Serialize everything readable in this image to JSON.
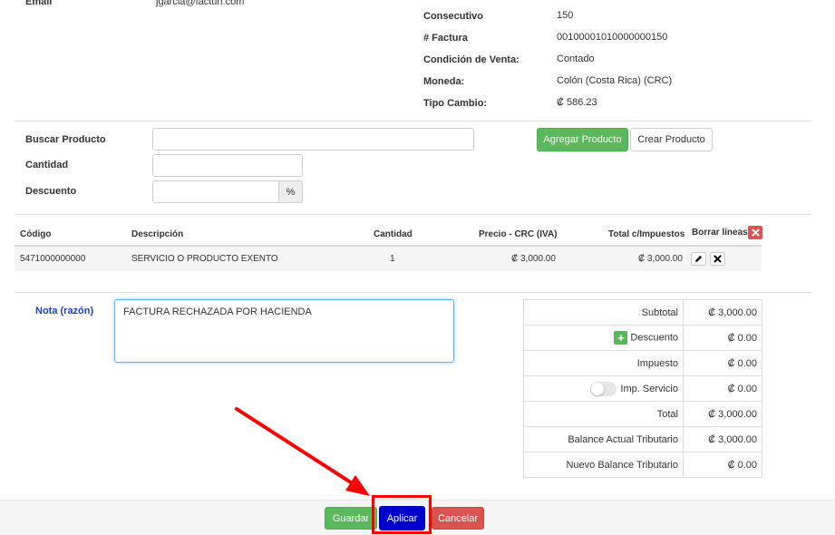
{
  "customer": {
    "email_label": "Email",
    "email_value": "jgarcia@factun.com"
  },
  "invoice": {
    "consecutivo_label": "Consecutivo",
    "consecutivo_value": "150",
    "factura_label": "# Factura",
    "factura_value": "00100001010000000150",
    "condicion_label": "Condición de Venta:",
    "condicion_value": "Contado",
    "moneda_label": "Moneda:",
    "moneda_value": "Colón (Costa Rica) (CRC)",
    "tipo_cambio_label": "Tipo Cambio:",
    "tipo_cambio_value": "₡ 586.23"
  },
  "product_form": {
    "buscar_label": "Buscar Producto",
    "buscar_value": "",
    "cantidad_label": "Cantidad",
    "cantidad_value": "",
    "descuento_label": "Descuento",
    "descuento_value": "",
    "percent_addon": "%",
    "agregar_button": "Agregar Producto",
    "crear_button": "Crear Producto"
  },
  "lines_table": {
    "headers": {
      "codigo": "Código",
      "descripcion": "Descripción",
      "cantidad": "Cantidad",
      "precio": "Precio - CRC (IVA)",
      "total": "Total c/Impuestos",
      "borrar": "Borrar líneas"
    },
    "rows": [
      {
        "codigo": "5471000000000",
        "descripcion": "SERVICIO O PRODUCTO EXENTO",
        "cantidad": "1",
        "precio": "₡ 3,000.00",
        "total": "₡ 3,000.00"
      }
    ]
  },
  "nota": {
    "label": "Nota (razón)",
    "value": "FACTURA RECHAZADA POR HACIENDA"
  },
  "totals": {
    "subtotal_label": "Subtotal",
    "subtotal_value": "₡ 3,000.00",
    "descuento_label": "Descuento",
    "descuento_value": "₡ 0.00",
    "impuesto_label": "Impuesto",
    "impuesto_value": "₡ 0.00",
    "imp_servicio_label": "Imp. Servicio",
    "imp_servicio_value": "₡ 0.00",
    "total_label": "Total",
    "total_value": "₡ 3,000.00",
    "balance_actual_label": "Balance Actual Tributario",
    "balance_actual_value": "₡ 3,000.00",
    "nuevo_balance_label": "Nuevo Balance Tributario",
    "nuevo_balance_value": "₡ 0.00"
  },
  "footer": {
    "guardar": "Guardar",
    "aplicar": "Aplicar",
    "cancelar": "Cancelar"
  },
  "colors": {
    "primary_green": "#5cb85c",
    "apply_blue": "#0000cc",
    "danger_red": "#d9534f",
    "annotation_red": "#ff0000",
    "nota_label_blue": "#1f3fbf"
  },
  "icons": {
    "edit": "pencil-icon",
    "delete": "close-icon",
    "borrar_all": "close-icon",
    "add_discount": "plus-icon",
    "annotation": "arrow-annotation"
  }
}
